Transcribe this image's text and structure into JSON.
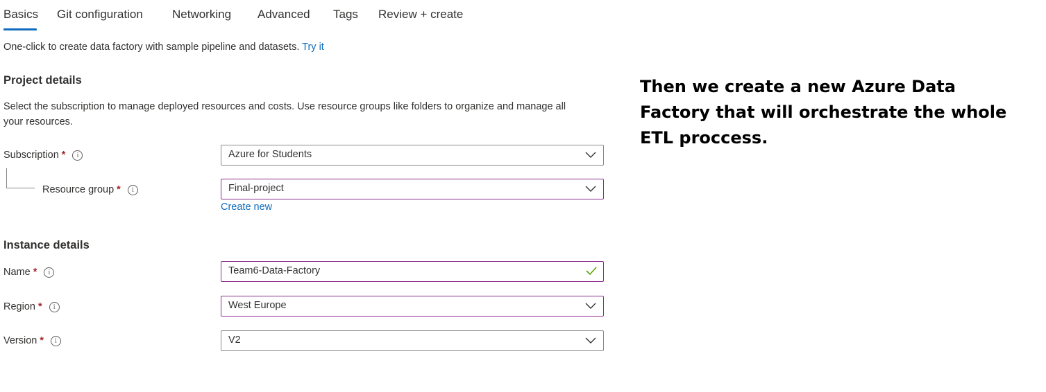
{
  "tabs": [
    {
      "label": "Basics",
      "active": true
    },
    {
      "label": "Git configuration",
      "active": false
    },
    {
      "label": "Networking",
      "active": false
    },
    {
      "label": "Advanced",
      "active": false
    },
    {
      "label": "Tags",
      "active": false
    },
    {
      "label": "Review + create",
      "active": false
    }
  ],
  "intro": {
    "text": "One-click to create data factory with sample pipeline and datasets.",
    "link": "Try it"
  },
  "project": {
    "title": "Project details",
    "description": "Select the subscription to manage deployed resources and costs. Use resource groups like folders to organize and manage all your resources.",
    "subscription": {
      "label": "Subscription",
      "required": "*",
      "value": "Azure for Students"
    },
    "resource_group": {
      "label": "Resource group",
      "required": "*",
      "value": "Final-project",
      "create_new": "Create new"
    }
  },
  "instance": {
    "title": "Instance details",
    "name": {
      "label": "Name",
      "required": "*",
      "value": "Team6-Data-Factory",
      "valid": true
    },
    "region": {
      "label": "Region",
      "required": "*",
      "value": "West Europe"
    },
    "version": {
      "label": "Version",
      "required": "*",
      "value": "V2"
    }
  },
  "annotation": "Then we create a new Azure Data Factory that will orchestrate the whole ETL proccess.",
  "colors": {
    "accent": "#0f6cbd",
    "required": "#a4262c",
    "focus_border": "#8a2b8c",
    "valid_check": "#57a300"
  },
  "icons": {
    "info": "info-circle-icon",
    "dropdown": "chevron-down-icon",
    "valid": "checkmark-icon"
  }
}
